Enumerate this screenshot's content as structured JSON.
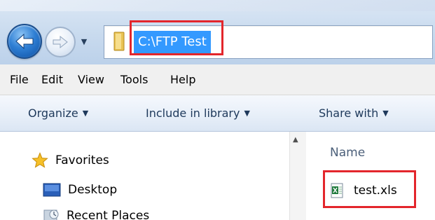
{
  "address": {
    "path": "C:\\FTP Test"
  },
  "menu": {
    "items": [
      "File",
      "Edit",
      "View",
      "Tools",
      "Help"
    ]
  },
  "commands": {
    "organize": "Organize",
    "include_in_library": "Include in library",
    "share_with": "Share with"
  },
  "navigation": {
    "items": [
      {
        "label": "Favorites",
        "icon": "star-icon"
      },
      {
        "label": "Desktop",
        "icon": "desktop-icon"
      },
      {
        "label": "Recent Places",
        "icon": "recent-places-icon"
      }
    ]
  },
  "files": {
    "column_name": "Name",
    "items": [
      {
        "name": "test.xls",
        "icon": "excel-file-icon"
      }
    ]
  },
  "colors": {
    "selection": "#3399ff",
    "highlight_box": "#e3262c"
  }
}
